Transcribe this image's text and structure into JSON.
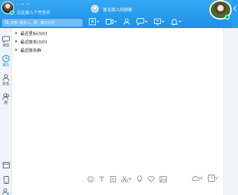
{
  "profile": {
    "nickname": "· ·· ··",
    "signature": "点此输入个性签名"
  },
  "search": {
    "placeholder": "搜索: 联系人、群、聊天记录"
  },
  "sidebar": {
    "items": [
      {
        "label": "消息",
        "icon": "message-icon"
      },
      {
        "label": "最近",
        "icon": "clock-icon"
      },
      {
        "label": "好友",
        "icon": "person-icon"
      },
      {
        "label": "群",
        "icon": "group-icon"
      }
    ],
    "bottom_icons": [
      "panel-icon",
      "phone-icon",
      "person-add-icon"
    ]
  },
  "list": {
    "rows": [
      "最近星标(0/0)",
      "最近联系(0/0)",
      "最近联系群"
    ]
  },
  "chat": {
    "title": "暂无接入的顾客",
    "toolbar_icons": [
      "screen-share-icon",
      "video-call-icon",
      "add-contact-icon",
      "chat-bubble-icon",
      "share-screen-icon",
      "bell-icon"
    ],
    "input_toolbar_icons": [
      "emoji-icon",
      "text-icon",
      "clipboard-icon",
      "scissors-icon",
      "lightbulb-icon",
      "heart-icon",
      "image-icon"
    ],
    "input_toolbar_right_icons": [
      "cloud-icon",
      "history-icon"
    ]
  },
  "colors": {
    "header_blue": "#1e90e8",
    "online_green": "#1bc35b"
  }
}
